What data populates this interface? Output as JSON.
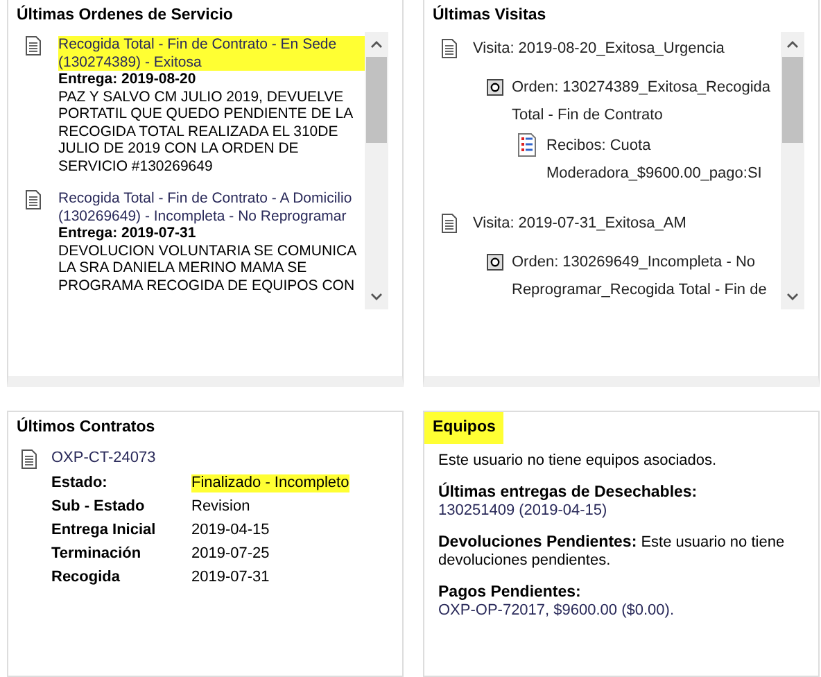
{
  "orders_panel": {
    "title": "Últimas Ordenes de Servicio",
    "items": [
      {
        "title": "Recogida Total - Fin de Contrato - En Sede (130274389) - Exitosa",
        "highlighted": true,
        "delivery": "Entrega: 2019-08-20",
        "note": "PAZ Y SALVO CM JULIO 2019, DEVUELVE PORTATIL QUE QUEDO PENDIENTE DE LA RECOGIDA TOTAL REALIZADA EL 310DE JULIO DE 2019 CON LA ORDEN DE SERVICIO #130269649"
      },
      {
        "title": "Recogida Total - Fin de Contrato - A Domicilio (130269649) - Incompleta - No Reprogramar",
        "highlighted": false,
        "delivery": "Entrega: 2019-07-31",
        "note": "DEVOLUCION VOLUNTARIA SE COMUNICA LA SRA DANIELA MERINO MAMA SE PROGRAMA RECOGIDA DE EQUIPOS CON"
      }
    ]
  },
  "visits_panel": {
    "title": "Últimas Visitas",
    "visits": [
      {
        "label": "Visita: 2019-08-20_Exitosa_Urgencia",
        "orders": [
          {
            "label": "Orden: 130274389_Exitosa_Recogida Total - Fin de Contrato",
            "receipts": [
              "Recibos: Cuota Moderadora_$9600.00_pago:SI"
            ]
          }
        ]
      },
      {
        "label": "Visita: 2019-07-31_Exitosa_AM",
        "orders": [
          {
            "label": "Orden: 130269649_Incompleta - No Reprogramar_Recogida Total - Fin de"
          }
        ]
      }
    ]
  },
  "contracts_panel": {
    "title": "Últimos Contratos",
    "contract_id": "OXP-CT-24073",
    "fields": [
      {
        "label": "Estado:",
        "value": "Finalizado - Incompleto",
        "highlighted": true
      },
      {
        "label": "Sub - Estado",
        "value": "Revision",
        "highlighted": false
      },
      {
        "label": "Entrega Inicial",
        "value": "2019-04-15",
        "highlighted": false
      },
      {
        "label": "Terminación",
        "value": "2019-07-25",
        "highlighted": false
      },
      {
        "label": "Recogida",
        "value": "2019-07-31",
        "highlighted": false
      }
    ]
  },
  "equipment_panel": {
    "title": "Equipos",
    "title_highlighted": true,
    "sections": [
      {
        "kind": "plain",
        "text": "Este usuario no tiene equipos asociados."
      },
      {
        "kind": "block",
        "label": "Últimas entregas de Desechables:",
        "text": "130251409 (2019-04-15)"
      },
      {
        "kind": "inline",
        "label": "Devoluciones Pendientes:",
        "text": "Este usuario no tiene devoluciones pendientes."
      },
      {
        "kind": "block",
        "label": "Pagos Pendientes:",
        "text": "OXP-OP-72017, $9600.00 ($0.00)."
      }
    ]
  }
}
